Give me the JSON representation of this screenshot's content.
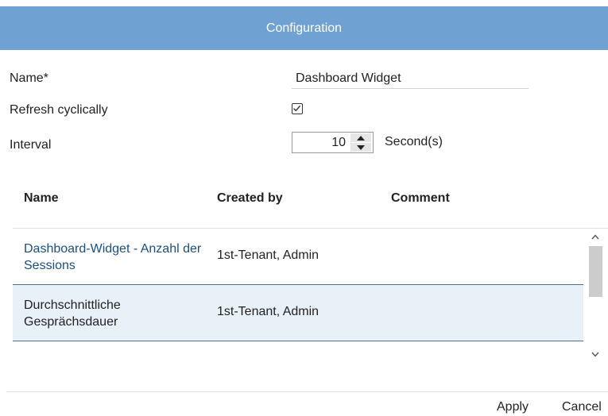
{
  "dialog": {
    "title": "Configuration"
  },
  "form": {
    "name_label": "Name*",
    "name_value": "Dashboard Widget",
    "refresh_label": "Refresh cyclically",
    "refresh_checked": true,
    "interval_label": "Interval",
    "interval_value": "10",
    "interval_unit": "Second(s)"
  },
  "table": {
    "columns": [
      "Name",
      "Created by",
      "Comment"
    ],
    "rows": [
      {
        "name": "Dashboard-Widget - Anzahl der Sessions",
        "created_by": "1st-Tenant, Admin",
        "comment": "",
        "selected": false
      },
      {
        "name": "Durchschnittliche Gesprächsdauer",
        "created_by": "1st-Tenant, Admin",
        "comment": "",
        "selected": true
      }
    ]
  },
  "footer": {
    "apply_label": "Apply",
    "cancel_label": "Cancel"
  },
  "colors": {
    "header_bg": "#6fa1d2",
    "selected_row_bg": "#e8f0f8",
    "link_text": "#1a4f82"
  }
}
